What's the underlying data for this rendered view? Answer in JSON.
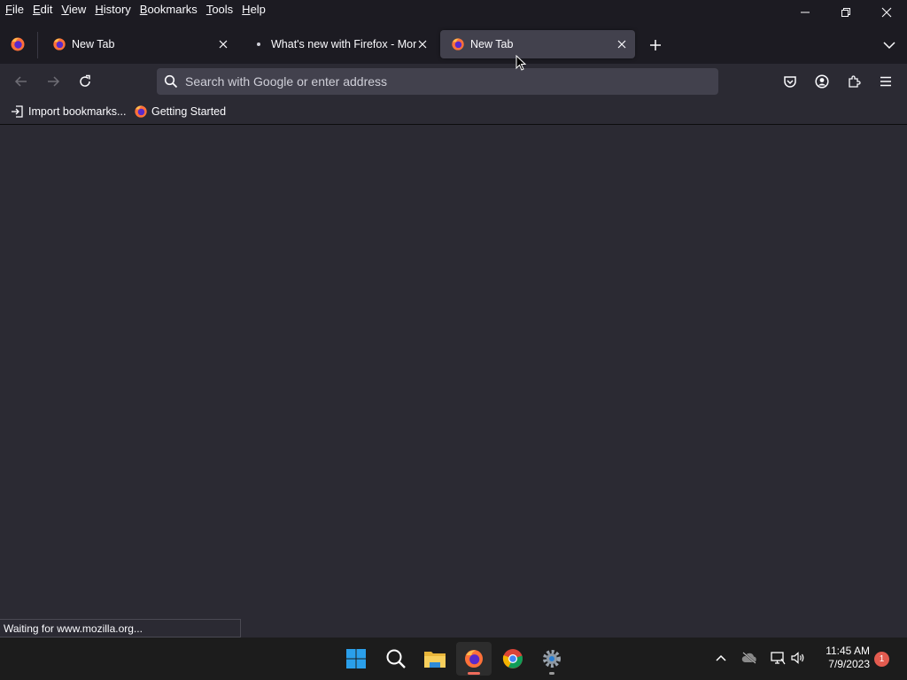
{
  "menubar": {
    "items": [
      "File",
      "Edit",
      "View",
      "History",
      "Bookmarks",
      "Tools",
      "Help"
    ]
  },
  "window_controls": [
    "minimize-icon",
    "restore-icon",
    "close-icon"
  ],
  "tabs": [
    {
      "title": "New Tab",
      "favicon": "firefox-icon",
      "selected": false
    },
    {
      "title": "What's new with Firefox - More",
      "favicon": "loading-dot-icon",
      "selected": false
    },
    {
      "title": "New Tab",
      "favicon": "firefox-icon",
      "selected": true
    }
  ],
  "urlbar": {
    "placeholder": "Search with Google or enter address",
    "value": ""
  },
  "bookmarks": [
    {
      "label": "Import bookmarks...",
      "icon": "import-icon"
    },
    {
      "label": "Getting Started",
      "icon": "firefox-icon"
    }
  ],
  "status": {
    "text": "Waiting for www.mozilla.org..."
  },
  "taskbar": {
    "apps": [
      "windows-start-icon",
      "search-icon",
      "file-explorer-icon",
      "firefox-icon",
      "chrome-icon",
      "settings-icon"
    ],
    "time": "11:45 AM",
    "date": "7/9/2023",
    "notification_count": "1"
  },
  "colors": {
    "chrome_dark": "#1c1b22",
    "toolbar": "#2b2a33",
    "urlbar": "#42414d",
    "text": "#fbfbfe",
    "taskbar": "#1c1c1c"
  }
}
